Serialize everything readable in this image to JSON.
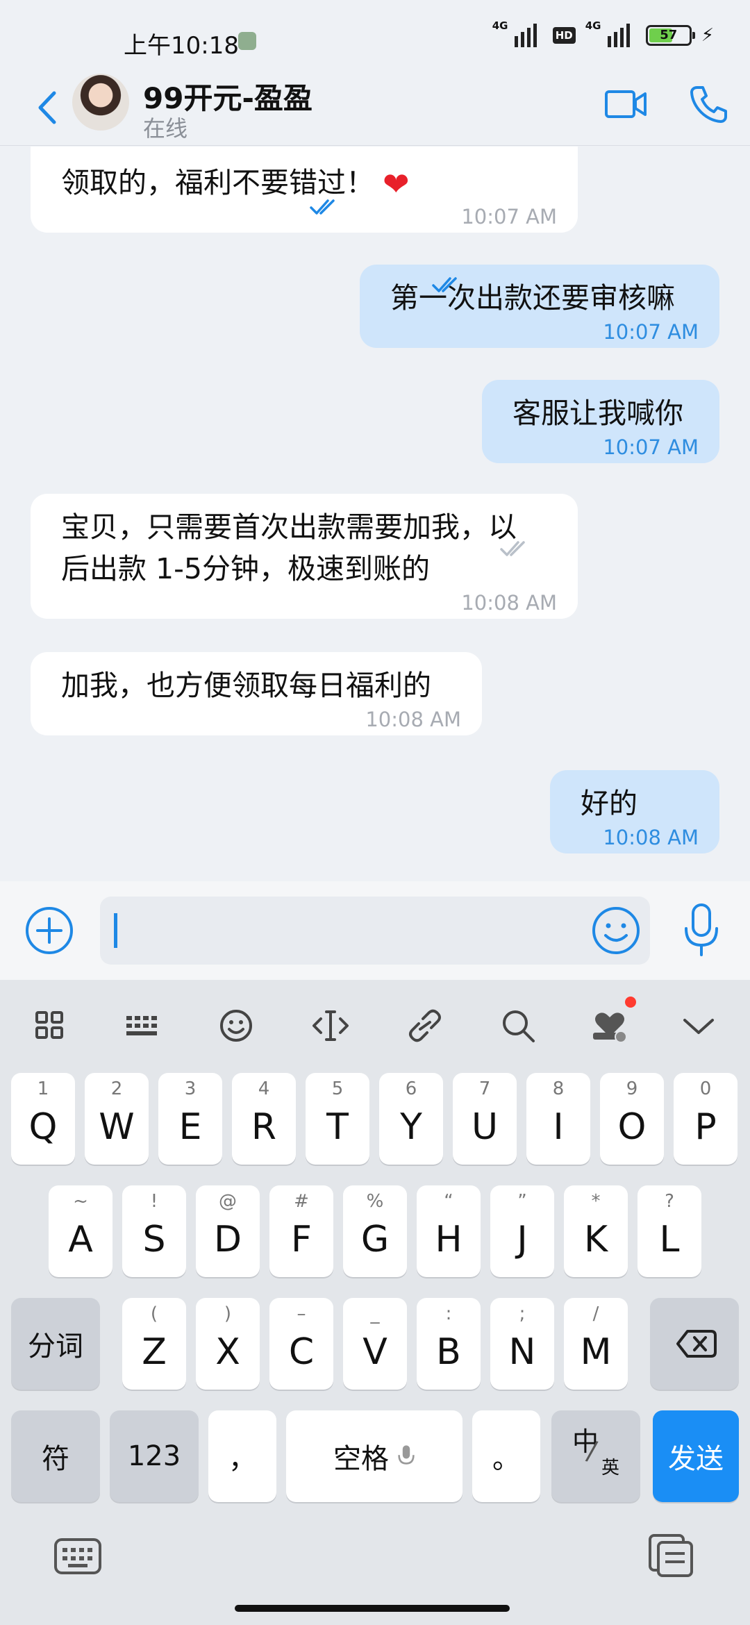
{
  "status_bar": {
    "time": "上午10:18",
    "net1": "4G",
    "hd": "HD",
    "net2": "4G",
    "battery": "57"
  },
  "header": {
    "contact_name": "99开元-盈盈",
    "contact_status": "在线"
  },
  "messages": [
    {
      "dir": "in",
      "text": "领取的，福利不要错过！",
      "time": "10:07 AM"
    },
    {
      "dir": "out",
      "text": "第一次出款还要审核嘛",
      "time": "10:07 AM",
      "read": true
    },
    {
      "dir": "out",
      "text": "客服让我喊你",
      "time": "10:07 AM",
      "read": true
    },
    {
      "dir": "in",
      "text_line1": "宝贝，只需要首次出款需要加我，以",
      "text_line2": "后出款 1-5分钟，极速到账的",
      "time": "10:08 AM"
    },
    {
      "dir": "in",
      "text": "加我，也方便领取每日福利的",
      "time": "10:08 AM"
    },
    {
      "dir": "out",
      "text": "好的",
      "time": "10:08 AM",
      "read": false
    }
  ],
  "input": {
    "value": "",
    "placeholder": ""
  },
  "keyboard": {
    "row1": [
      {
        "k": "Q",
        "s": "1"
      },
      {
        "k": "W",
        "s": "2"
      },
      {
        "k": "E",
        "s": "3"
      },
      {
        "k": "R",
        "s": "4"
      },
      {
        "k": "T",
        "s": "5"
      },
      {
        "k": "Y",
        "s": "6"
      },
      {
        "k": "U",
        "s": "7"
      },
      {
        "k": "I",
        "s": "8"
      },
      {
        "k": "O",
        "s": "9"
      },
      {
        "k": "P",
        "s": "0"
      }
    ],
    "row2": [
      {
        "k": "A",
        "s": "~"
      },
      {
        "k": "S",
        "s": "!"
      },
      {
        "k": "D",
        "s": "@"
      },
      {
        "k": "F",
        "s": "#"
      },
      {
        "k": "G",
        "s": "%"
      },
      {
        "k": "H",
        "s": "“"
      },
      {
        "k": "J",
        "s": "”"
      },
      {
        "k": "K",
        "s": "*"
      },
      {
        "k": "L",
        "s": "?"
      }
    ],
    "row3": [
      {
        "k": "Z",
        "s": "("
      },
      {
        "k": "X",
        "s": ")"
      },
      {
        "k": "C",
        "s": "–"
      },
      {
        "k": "V",
        "s": "_"
      },
      {
        "k": "B",
        "s": ":"
      },
      {
        "k": "N",
        "s": ";"
      },
      {
        "k": "M",
        "s": "/"
      }
    ],
    "segment_label": "分词",
    "symbol_label": "符",
    "num_label": "123",
    "comma_label": "，",
    "space_label": "空格",
    "period_label": "。",
    "lang_zh": "中",
    "lang_en": "英",
    "send_label": "发送"
  },
  "colors": {
    "accent": "#1e88e5",
    "bubble_out": "#cfe5fb",
    "bubble_in": "#ffffff",
    "send_key": "#1a8ef5",
    "notif_dot": "#ff3b30"
  },
  "icons": [
    "back-chevron-icon",
    "video-call-icon",
    "phone-icon",
    "read-ticks-icon",
    "add-circle-icon",
    "emoji-icon",
    "microphone-icon",
    "grid-icon",
    "keyboard-icon",
    "smiley-icon",
    "cursor-icon",
    "link-icon",
    "search-icon",
    "heart-sticker-icon",
    "collapse-chevron-icon",
    "backspace-icon",
    "keyboard-switch-icon",
    "clipboard-icon"
  ]
}
